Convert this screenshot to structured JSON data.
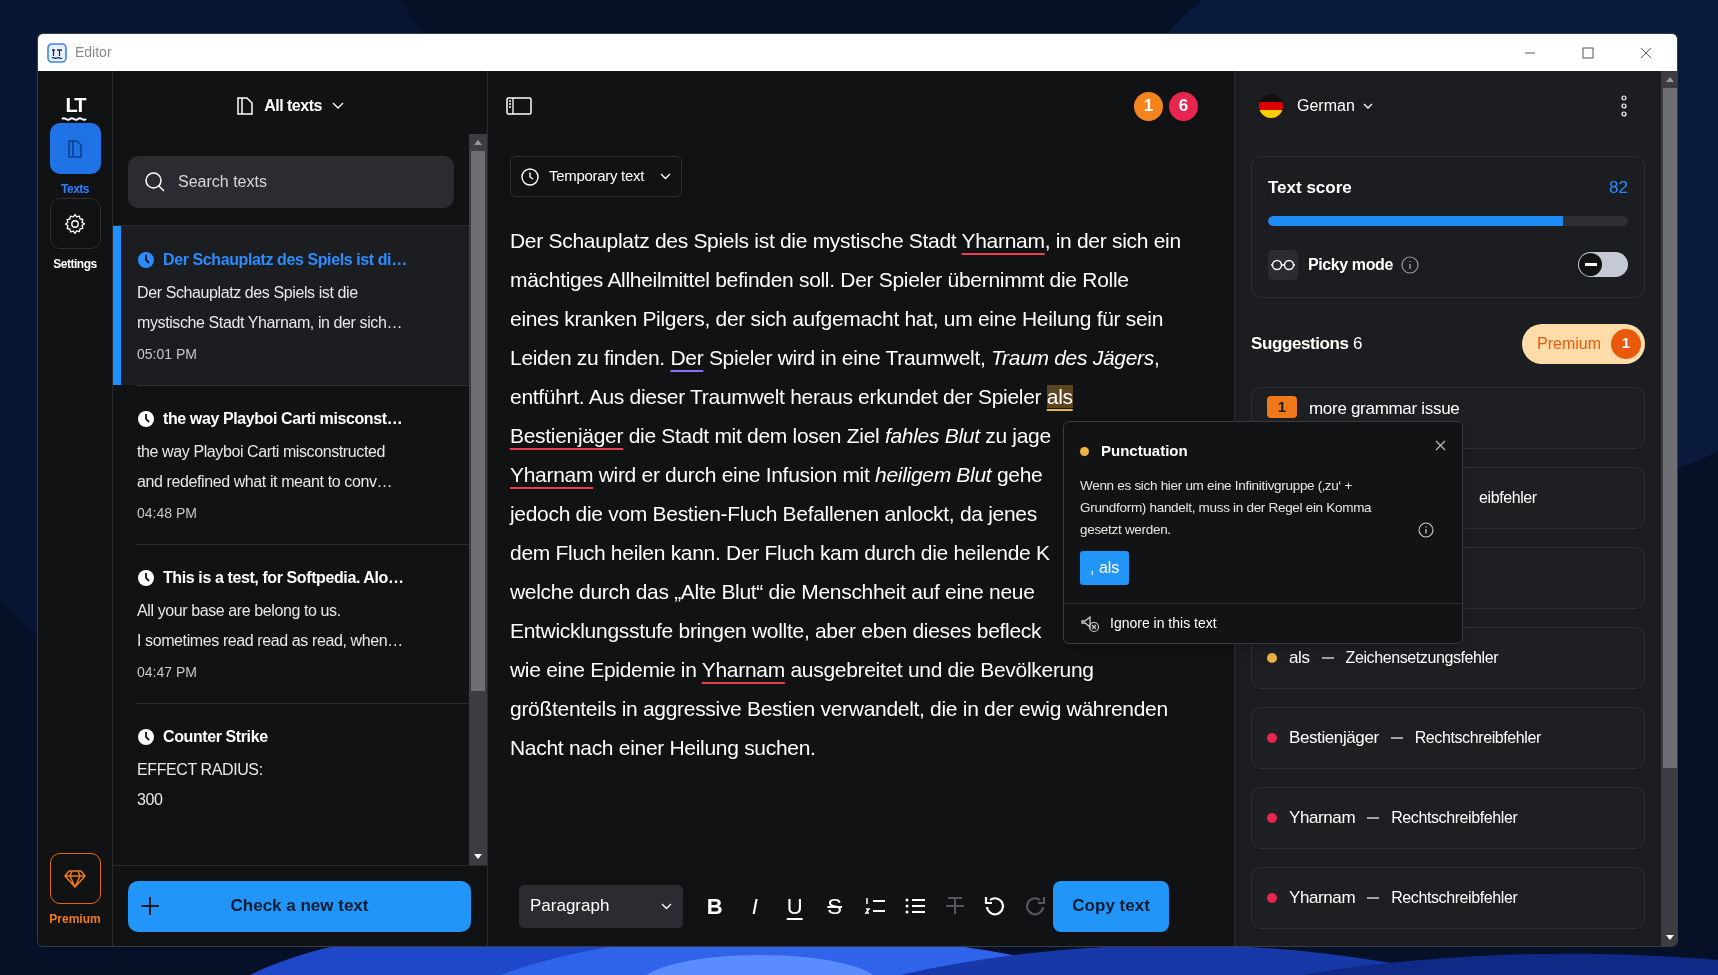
{
  "window": {
    "title": "Editor"
  },
  "rail": {
    "logo": "LT",
    "items": [
      {
        "kind": "texts",
        "label": "Texts",
        "selected": true
      },
      {
        "kind": "settings",
        "label": "Settings",
        "selected": false
      }
    ],
    "premium": "Premium"
  },
  "list": {
    "filter": "All texts",
    "search": {
      "placeholder": "Search texts"
    },
    "items": [
      {
        "title": "Der Schauplatz des Spiels ist di…",
        "preview": [
          "Der Schauplatz des Spiels ist die",
          "mystische Stadt Yharnam, in der sich…"
        ],
        "time": "05:01 PM",
        "selected": true
      },
      {
        "title": "the way Playboi Carti misconst…",
        "preview": [
          "the way Playboi Carti misconstructed",
          "and redefined what it meant to conv…"
        ],
        "time": "04:48 PM",
        "selected": false
      },
      {
        "title": "This is a test, for Softpedia. Alo…",
        "preview": [
          "All your base are belong to us.",
          "I sometimes read read as read, when…"
        ],
        "time": "04:47 PM",
        "selected": false
      },
      {
        "title": "Counter Strike",
        "preview": [
          "EFFECT RADIUS:",
          "300"
        ],
        "selected": false
      }
    ],
    "new_button": "Check a new text"
  },
  "editor": {
    "counts": [
      {
        "value": "1",
        "color": "#f5841f"
      },
      {
        "value": "6",
        "color": "#e8254f"
      }
    ],
    "mode": "Temporary text",
    "lines": [
      [
        {
          "kind": "text",
          "text": "Der Schauplatz des Spiels ist die mystische Stadt "
        },
        {
          "kind": "spelling",
          "text": "Yharnam"
        },
        {
          "kind": "text",
          "text": ", in der sich ein"
        }
      ],
      [
        {
          "kind": "text",
          "text": "mächtiges Allheilmittel befinden soll. Der Spieler übernimmt die Rolle"
        }
      ],
      [
        {
          "kind": "text",
          "text": "eines kranken Pilgers, der sich aufgemacht hat, um eine Heilung für sein"
        }
      ],
      [
        {
          "kind": "text",
          "text": "Leiden zu finden. "
        },
        {
          "kind": "style",
          "text": "Der"
        },
        {
          "kind": "text",
          "text": " Spieler wird in eine Traumwelt, "
        },
        {
          "kind": "italic",
          "text": "Traum des Jägers"
        },
        {
          "kind": "text",
          "text": ","
        }
      ],
      [
        {
          "kind": "text",
          "text": "entführt. Aus dieser Traumwelt heraus erkundet der Spieler "
        },
        {
          "kind": "punct",
          "text": "als"
        }
      ],
      [
        {
          "kind": "spelling",
          "text": "Bestienjäger"
        },
        {
          "kind": "text",
          "text": " die Stadt mit dem losen Ziel "
        },
        {
          "kind": "italic",
          "text": "fahles Blut"
        },
        {
          "kind": "text",
          "text": " zu jage"
        }
      ],
      [
        {
          "kind": "spelling",
          "text": "Yharnam"
        },
        {
          "kind": "text",
          "text": " wird er durch eine Infusion mit "
        },
        {
          "kind": "italic",
          "text": "heiligem Blut"
        },
        {
          "kind": "text",
          "text": " gehe"
        }
      ],
      [
        {
          "kind": "text",
          "text": "jedoch die vom Bestien-Fluch Befallenen anlockt, da jenes"
        }
      ],
      [
        {
          "kind": "text",
          "text": "dem Fluch heilen kann. Der Fluch kam durch die heilende K"
        }
      ],
      [
        {
          "kind": "text",
          "text": "welche durch das „Alte Blut“ die Menschheit auf eine neue"
        }
      ],
      [
        {
          "kind": "text",
          "text": "Entwicklungsstufe bringen wollte, aber eben dieses befleck"
        }
      ],
      [
        {
          "kind": "text",
          "text": "wie eine Epidemie in "
        },
        {
          "kind": "spelling",
          "text": "Yharnam"
        },
        {
          "kind": "text",
          "text": " ausgebreitet und die Bevölkerung"
        }
      ],
      [
        {
          "kind": "text",
          "text": "größtenteils in aggressive Bestien verwandelt, die in der ewig währenden"
        }
      ],
      [
        {
          "kind": "text",
          "text": "Nacht nach einer Heilung suchen."
        }
      ]
    ],
    "toolbar": {
      "style": "Paragraph",
      "tools": [
        {
          "kind": "bold",
          "glyph": "B",
          "disabled": false
        },
        {
          "kind": "italic",
          "glyph": "I",
          "disabled": false
        },
        {
          "kind": "underline",
          "glyph": "U",
          "disabled": false
        },
        {
          "kind": "strike",
          "glyph": "S",
          "disabled": false
        },
        {
          "kind": "ordered",
          "disabled": false
        },
        {
          "kind": "bullets",
          "disabled": false
        },
        {
          "kind": "clear",
          "disabled": true
        },
        {
          "kind": "undo",
          "disabled": false
        },
        {
          "kind": "redo",
          "disabled": true
        }
      ],
      "copy": "Copy text"
    }
  },
  "popup": {
    "category": "Punctuation",
    "color": "#f0b143",
    "message": "Wenn es sich hier um eine Infinitivgruppe (‚zu‘ + Grundform) handelt, muss in der Regel ein Komma gesetzt werden.",
    "replacement": ", als",
    "ignore": "Ignore in this text"
  },
  "panel": {
    "language": "German",
    "score": {
      "label": "Text score",
      "value": "82",
      "level": 0.82
    },
    "picky": {
      "label": "Picky mode",
      "checked": false
    },
    "suggestions_title": "**Suggestions** 6",
    "premium": {
      "label": "Premium",
      "count": "1"
    },
    "suggestions": [
      {
        "kind": "count",
        "count": "1",
        "label": "more grammar issue"
      },
      {
        "kind": "covered",
        "label": "eibfehler"
      },
      {
        "kind": "covered"
      },
      {
        "kind": "issue",
        "color": "#f0b143",
        "word": "als",
        "type": "Zeichensetzungsfehler"
      },
      {
        "kind": "issue",
        "color": "#e8254f",
        "word": "Bestienjäger",
        "type": "Rechtschreibfehler"
      },
      {
        "kind": "issue",
        "color": "#e8254f",
        "word": "Yharnam",
        "type": "Rechtschreibfehler"
      },
      {
        "kind": "issue",
        "color": "#e8254f",
        "word": "Yharnam",
        "type": "Rechtschreibfehler"
      }
    ]
  }
}
